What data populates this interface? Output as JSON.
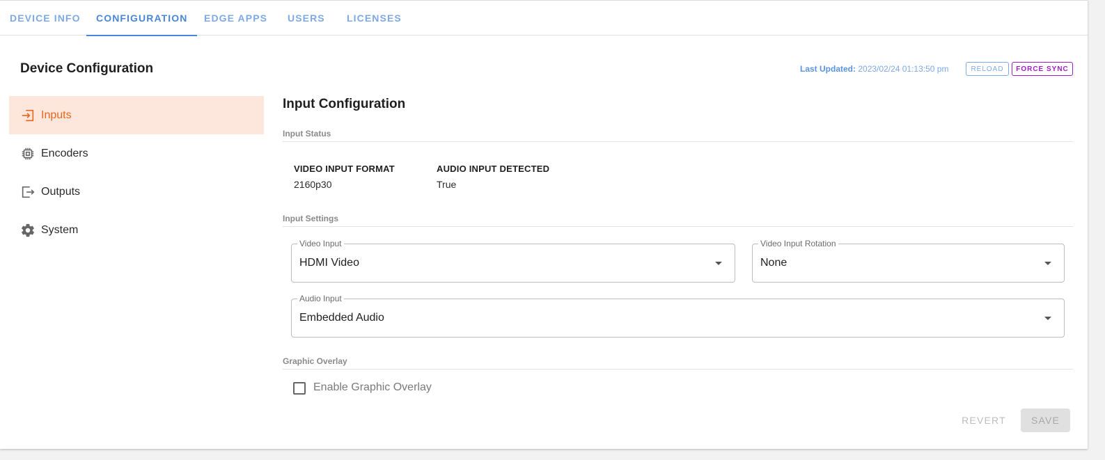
{
  "tabs": [
    {
      "label": "DEVICE INFO",
      "active": false
    },
    {
      "label": "CONFIGURATION",
      "active": true
    },
    {
      "label": "EDGE APPS",
      "active": false
    },
    {
      "label": "USERS",
      "active": false
    },
    {
      "label": "LICENSES",
      "active": false
    }
  ],
  "page": {
    "title": "Device Configuration",
    "last_updated_label": "Last Updated:",
    "last_updated_value": "2023/02/24 01:13:50 pm",
    "reload_label": "RELOAD",
    "force_sync_label": "FORCE SYNC"
  },
  "nav": {
    "items": [
      {
        "label": "Inputs",
        "icon": "input-icon",
        "active": true
      },
      {
        "label": "Encoders",
        "icon": "chip-icon",
        "active": false
      },
      {
        "label": "Outputs",
        "icon": "output-icon",
        "active": false
      },
      {
        "label": "System",
        "icon": "gear-icon",
        "active": false
      }
    ]
  },
  "main": {
    "title": "Input Configuration",
    "input_status_heading": "Input Status",
    "stats": [
      {
        "label": "VIDEO INPUT FORMAT",
        "value": "2160p30"
      },
      {
        "label": "AUDIO INPUT DETECTED",
        "value": "True"
      }
    ],
    "input_settings_heading": "Input Settings",
    "video_input": {
      "label": "Video Input",
      "value": "HDMI Video"
    },
    "video_rotation": {
      "label": "Video Input Rotation",
      "value": "None"
    },
    "audio_input": {
      "label": "Audio Input",
      "value": "Embedded Audio"
    },
    "graphic_overlay_heading": "Graphic Overlay",
    "graphic_overlay_checkbox": {
      "label": "Enable Graphic Overlay",
      "checked": false
    },
    "revert_label": "REVERT",
    "save_label": "SAVE"
  },
  "colors": {
    "accent_blue": "#4a86d8",
    "active_orange": "#e8661e",
    "active_bg": "#fde7dc",
    "force_sync_purple": "#a11cc4"
  }
}
